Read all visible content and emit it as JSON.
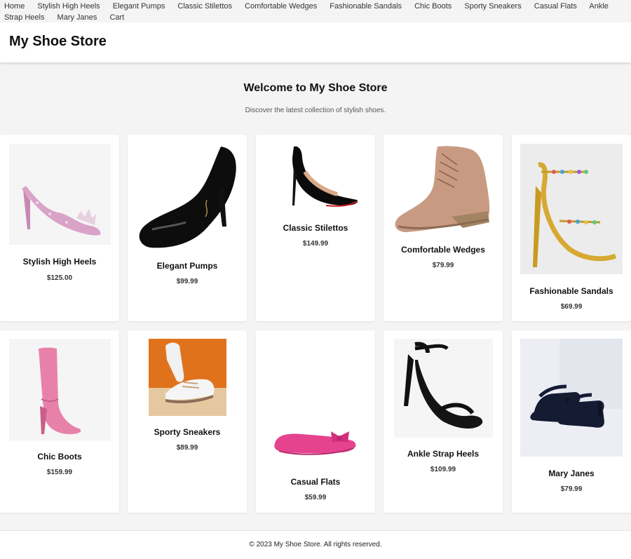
{
  "nav": [
    "Home",
    "Stylish High Heels",
    "Elegant Pumps",
    "Classic Stilettos",
    "Comfortable Wedges",
    "Fashionable Sandals",
    "Chic Boots",
    "Sporty Sneakers",
    "Casual Flats",
    "Ankle Strap Heels",
    "Mary Janes",
    "Cart"
  ],
  "header": {
    "title": "My Shoe Store"
  },
  "welcome": {
    "title": "Welcome to My Shoe Store",
    "subtitle": "Discover the latest collection of stylish shoes."
  },
  "products": [
    {
      "name": "Stylish High Heels",
      "price": "$125.00",
      "icon": "glitter-heel-icon"
    },
    {
      "name": "Elegant Pumps",
      "price": "$99.99",
      "icon": "black-pump-icon"
    },
    {
      "name": "Classic Stilettos",
      "price": "$149.99",
      "icon": "stiletto-icon"
    },
    {
      "name": "Comfortable Wedges",
      "price": "$79.99",
      "icon": "wedge-boot-icon"
    },
    {
      "name": "Fashionable Sandals",
      "price": "$69.99",
      "icon": "gold-sandal-icon"
    },
    {
      "name": "Chic Boots",
      "price": "$159.99",
      "icon": "pink-boot-icon"
    },
    {
      "name": "Sporty Sneakers",
      "price": "$89.99",
      "icon": "sneaker-icon"
    },
    {
      "name": "Casual Flats",
      "price": "$59.99",
      "icon": "pink-flat-icon"
    },
    {
      "name": "Ankle Strap Heels",
      "price": "$109.99",
      "icon": "strap-heel-icon"
    },
    {
      "name": "Mary Janes",
      "price": "$79.99",
      "icon": "mary-jane-icon"
    }
  ],
  "footer": {
    "text": "© 2023 My Shoe Store. All rights reserved."
  }
}
